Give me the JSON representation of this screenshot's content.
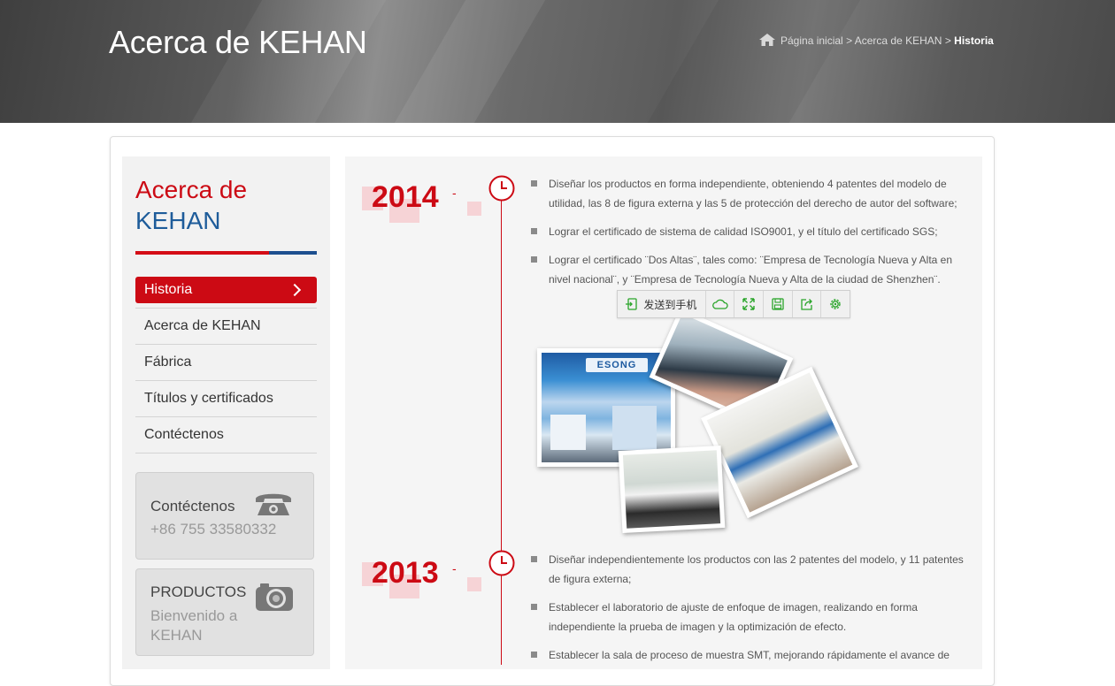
{
  "header": {
    "title": "Acerca de KEHAN",
    "breadcrumb": {
      "home": "Página inicial",
      "sep1": ">",
      "section": "Acerca de KEHAN",
      "sep2": ">",
      "current": "Historia"
    }
  },
  "sidebar": {
    "title_line1": "Acerca de",
    "title_line2": "KEHAN",
    "items": [
      {
        "label": "Historia",
        "active": true
      },
      {
        "label": "Acerca de KEHAN"
      },
      {
        "label": "Fábrica"
      },
      {
        "label": "Títulos y certificados"
      },
      {
        "label": "Contéctenos"
      }
    ],
    "contact_box": {
      "heading": "Contéctenos",
      "phone": "+86 755 33580332",
      "icon": "telephone-icon"
    },
    "products_box": {
      "heading": "PRODUCTOS",
      "line1": "Bienvenido a",
      "line2": "KEHAN",
      "icon": "camera-icon"
    }
  },
  "timeline": [
    {
      "year": "2014",
      "dash": "-",
      "items": [
        "Diseñar los productos en forma independiente, obteniendo 4 patentes del modelo de utilidad, las 8 de figura externa y las 5 de protección del derecho de autor del software;",
        "Lograr el certificado de sistema de calidad ISO9001, y el título del certificado SGS;",
        "Lograr el certificado ¨Dos Altas¨, tales como: ¨Empresa de Tecnología Nueva y Alta en nivel nacional¨, y ¨Empresa de Tecnología Nueva y Alta de la ciudad de Shenzhen¨."
      ],
      "photo_sign": "ESONG"
    },
    {
      "year": "2013",
      "dash": "-",
      "items": [
        "Diseñar independientemente los productos con las 2 patentes del modelo, y 11 patentes de figura externa;",
        "Establecer el laboratorio de ajuste de enfoque de imagen, realizando en forma independiente la prueba de imagen y la optimización de efecto.",
        "Establecer la sala de proceso de muestra SMT, mejorando rápidamente el avance de"
      ]
    }
  ],
  "toolbar": {
    "send_label": "发送到手机",
    "icons": [
      "send-to-phone-icon",
      "cloud-icon",
      "fullscreen-icon",
      "save-icon",
      "share-icon",
      "settings-icon"
    ]
  },
  "colors": {
    "brand_red": "#cc0a14",
    "brand_blue": "#1e5c9a",
    "toolbar_green": "#2aa52a"
  }
}
